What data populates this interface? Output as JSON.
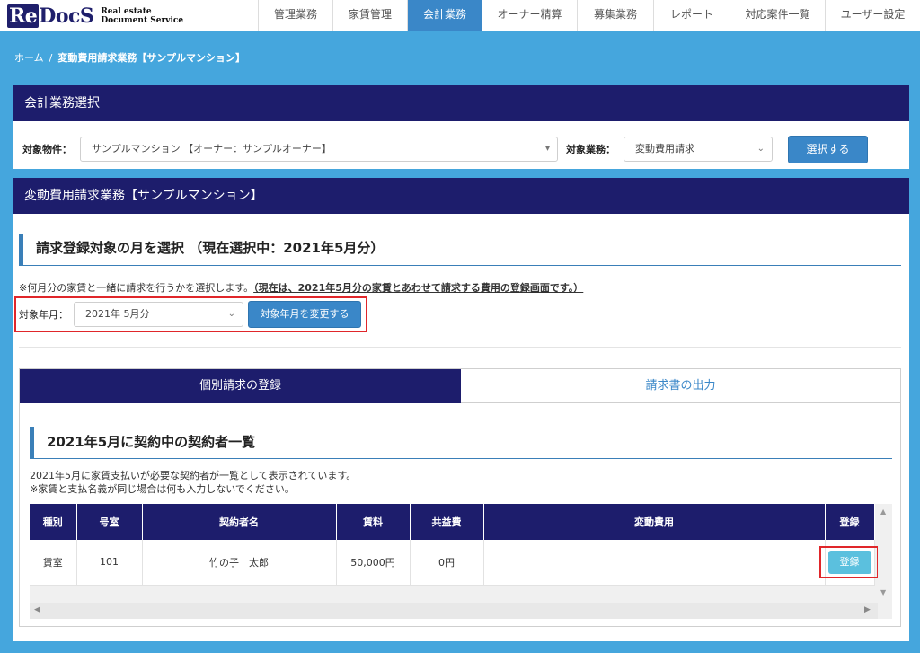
{
  "logo": {
    "mark_re": "Re",
    "mark_rest": "DocS",
    "sub_line1": "Real estate",
    "sub_line2": "Document Service"
  },
  "nav": [
    {
      "label": "管理業務"
    },
    {
      "label": "家賃管理"
    },
    {
      "label": "会計業務",
      "active": true
    },
    {
      "label": "オーナー精算"
    },
    {
      "label": "募集業務"
    },
    {
      "label": "レポート"
    },
    {
      "label": "対応案件一覧"
    },
    {
      "label": "ユーザー設定"
    }
  ],
  "breadcrumb": {
    "home": "ホーム",
    "separator": "/",
    "current": "変動費用請求業務【サンプルマンション】"
  },
  "panel1": {
    "title": "会計業務選択",
    "property_label": "対象物件：",
    "property_value": "サンプルマンション 【オーナー：サンプルオーナー】",
    "task_label": "対象業務：",
    "task_value": "変動費用請求",
    "select_button": "選択する"
  },
  "panel2": {
    "title": "変動費用請求業務【サンプルマンション】",
    "section_title": "請求登録対象の月を選択 （現在選択中：2021年5月分）",
    "note_plain": "※何月分の家賃と一緒に請求を行うかを選択します。",
    "note_underline": "（現在は、2021年5月分の家賃とあわせて請求する費用の登録画面です。）",
    "month_label": "対象年月：",
    "month_value": "2021年 5月分",
    "change_button": "対象年月を変更する"
  },
  "tabs": {
    "active": "個別請求の登録",
    "inactive": "請求書の出力"
  },
  "list": {
    "title": "2021年5月に契約中の契約者一覧",
    "desc_line1": "2021年5月に家賃支払いが必要な契約者が一覧として表示されています。",
    "desc_line2": "※家賃と支払名義が同じ場合は何も入力しないでください。",
    "headers": {
      "type": "種別",
      "room": "号室",
      "name": "契約者名",
      "rent": "賃料",
      "common": "共益費",
      "variable": "変動費用",
      "register": "登録"
    },
    "rows": [
      {
        "type": "賃室",
        "room": "101",
        "name": "竹の子　太郎",
        "rent": "50,000円",
        "common": "0円",
        "variable": "",
        "register_button": "登録"
      }
    ]
  },
  "colors": {
    "navy": "#1d1d6c",
    "accent_blue": "#3a87c8",
    "page_bg": "#45a6dd",
    "highlight_red": "#e0262a",
    "register_btn": "#5bc0de"
  },
  "icons": {
    "select_arrow": "chevron-down-icon",
    "scroll_up": "triangle-up-icon",
    "scroll_down": "triangle-down-icon",
    "scroll_left": "triangle-left-icon",
    "scroll_right": "triangle-right-icon"
  }
}
